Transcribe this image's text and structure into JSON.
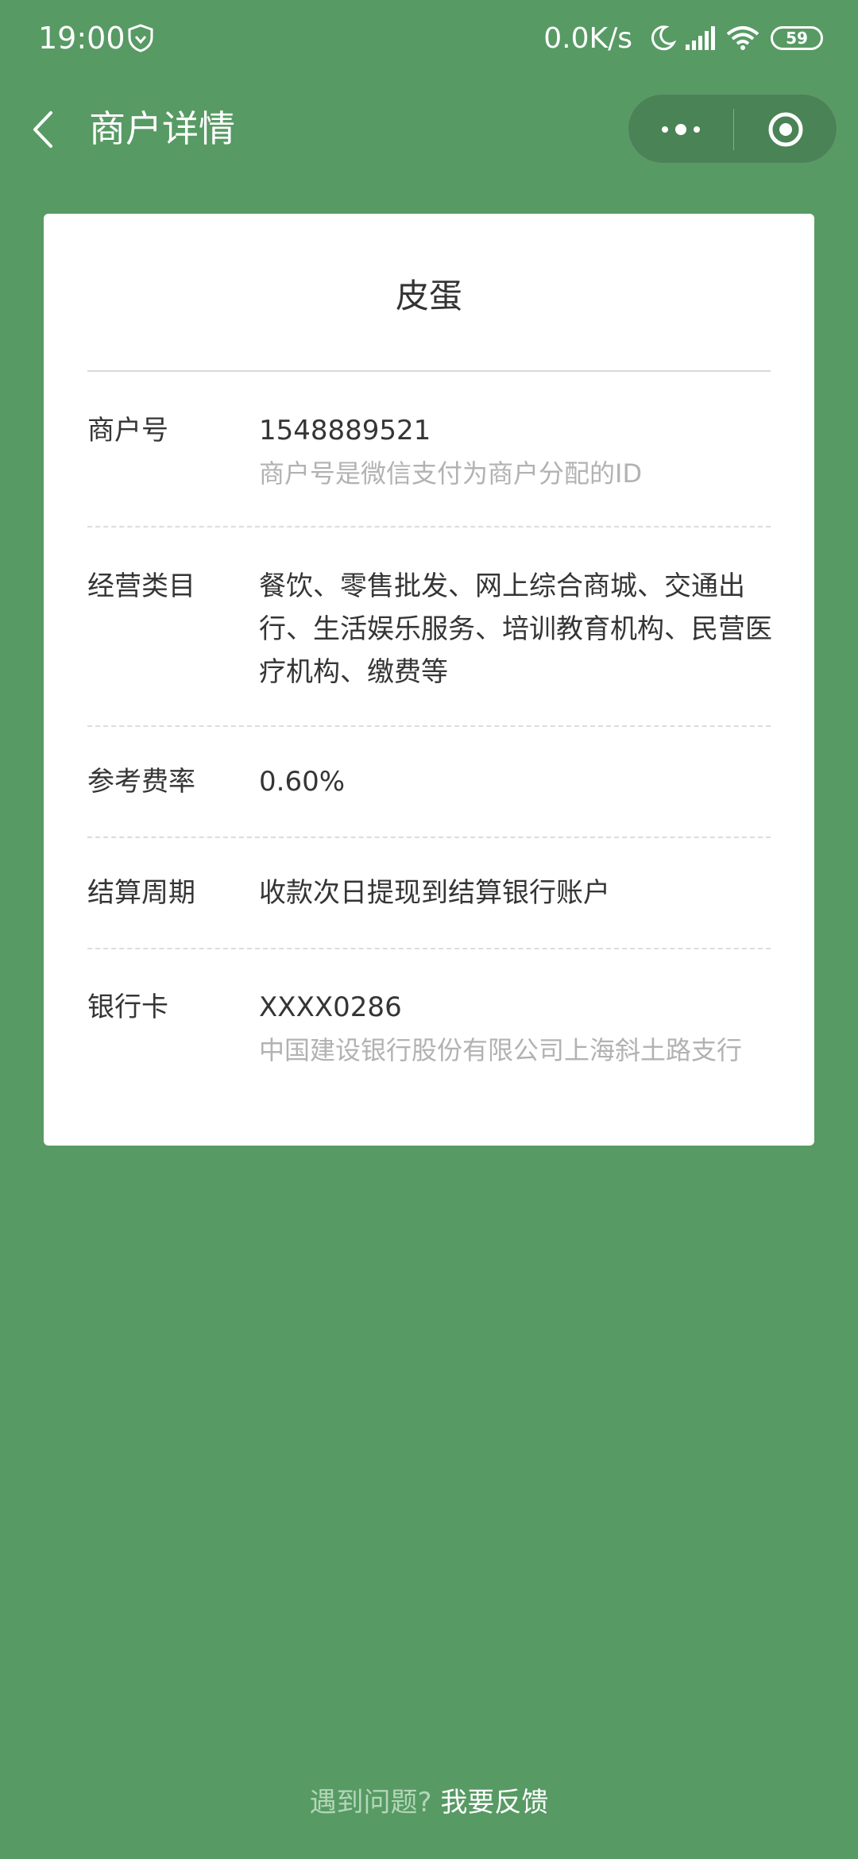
{
  "status_bar": {
    "time": "19:00",
    "net_speed": "0.0K/s",
    "battery": "59",
    "icons": [
      "shield-icon",
      "moon-icon",
      "signal-icon",
      "wifi-icon",
      "battery-icon"
    ]
  },
  "nav": {
    "title": "商户详情",
    "icons": [
      "back-icon",
      "more-icon",
      "close-icon"
    ]
  },
  "card": {
    "merchant_name": "皮蛋",
    "rows": [
      {
        "label": "商户号",
        "value": "1548889521",
        "sub": "商户号是微信支付为商户分配的ID"
      },
      {
        "label": "经营类目",
        "value": "餐饮、零售批发、网上综合商城、交通出行、生活娱乐服务、培训教育机构、民营医疗机构、缴费等"
      },
      {
        "label": "参考费率",
        "value": "0.60%"
      },
      {
        "label": "结算周期",
        "value": "收款次日提现到结算银行账户"
      },
      {
        "label": "银行卡",
        "value": "XXXX0286",
        "sub": "中国建设银行股份有限公司上海斜土路支行"
      }
    ]
  },
  "footer": {
    "question": "遇到问题?",
    "link": "我要反馈"
  },
  "colors": {
    "background": "#579a64",
    "card": "#ffffff",
    "secondary_text": "#b2b2b2"
  }
}
